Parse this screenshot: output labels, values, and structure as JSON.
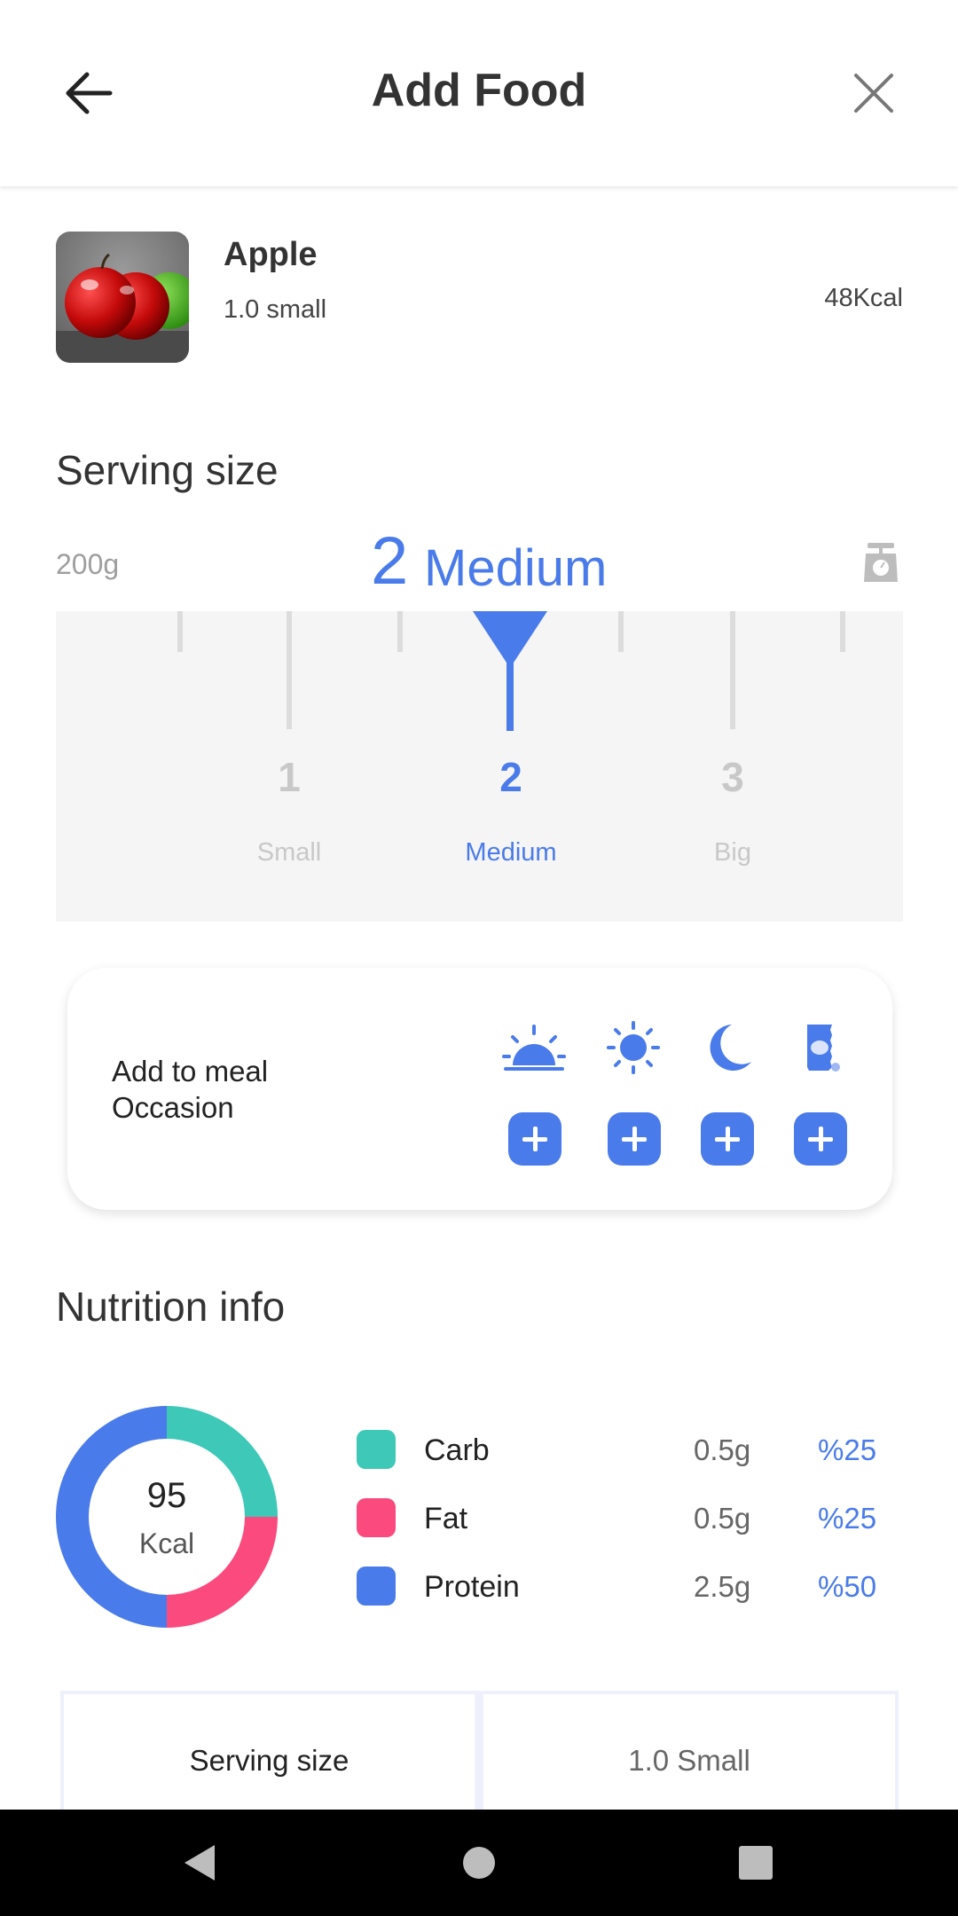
{
  "header": {
    "title": "Add Food"
  },
  "food": {
    "name": "Apple",
    "quantity": "1.0 small",
    "calories": "48Kcal"
  },
  "serving": {
    "heading": "Serving size",
    "weight": "200g",
    "selected_number": "2",
    "selected_name": "Medium",
    "options": [
      {
        "number": "1",
        "label": "Small"
      },
      {
        "number": "2",
        "label": "Medium"
      },
      {
        "number": "3",
        "label": "Big"
      }
    ]
  },
  "meal": {
    "label": "Add to meal Occasion",
    "occasions": [
      "breakfast-icon",
      "lunch-icon",
      "dinner-icon",
      "snack-icon"
    ]
  },
  "nutrition": {
    "heading": "Nutrition info",
    "total_kcal": "95",
    "unit": "Kcal",
    "items": [
      {
        "name": "Carb",
        "grams": "0.5g",
        "percent": "%25",
        "fraction": 0.25,
        "color": "#3ec8b8"
      },
      {
        "name": "Fat",
        "grams": "0.5g",
        "percent": "%25",
        "fraction": 0.25,
        "color": "#fb4a7d"
      },
      {
        "name": "Protein",
        "grams": "2.5g",
        "percent": "%50",
        "fraction": 0.5,
        "color": "#4a7bea"
      }
    ]
  },
  "details_table": {
    "label": "Serving size",
    "value": "1.0 Small"
  },
  "colors": {
    "accent": "#4a7bea",
    "carb": "#3ec8b8",
    "fat": "#fb4a7d",
    "protein": "#4a7bea"
  }
}
